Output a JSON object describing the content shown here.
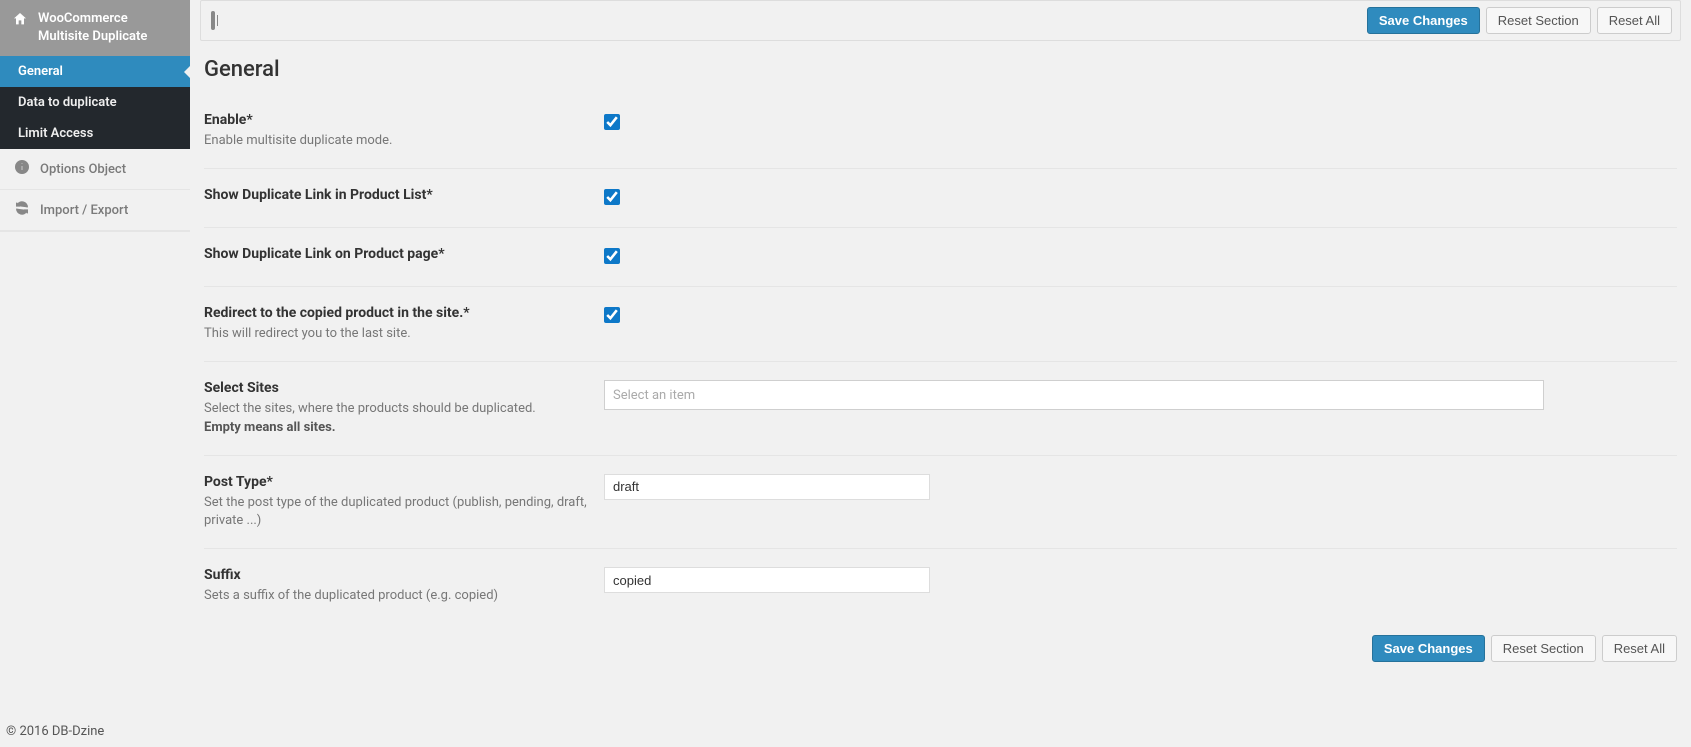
{
  "sidebar": {
    "title_line1": "WooCommerce",
    "title_line2": "Multisite Duplicate",
    "items": [
      {
        "label": "General",
        "active": true
      },
      {
        "label": "Data to duplicate",
        "active": false
      },
      {
        "label": "Limit Access",
        "active": false
      }
    ],
    "util_options_label": "Options Object",
    "util_import_label": "Import / Export"
  },
  "buttons": {
    "save": "Save Changes",
    "reset_section": "Reset Section",
    "reset_all": "Reset All"
  },
  "section": {
    "title": "General"
  },
  "fields": {
    "enable": {
      "label": "Enable*",
      "desc": "Enable multisite duplicate mode.",
      "checked": true
    },
    "show_list": {
      "label": "Show Duplicate Link in Product List*",
      "checked": true
    },
    "show_page": {
      "label": "Show Duplicate Link on Product page*",
      "checked": true
    },
    "redirect": {
      "label": "Redirect to the copied product in the site.*",
      "desc": "This will redirect you to the last site.",
      "checked": true
    },
    "select_sites": {
      "label": "Select Sites",
      "desc": "Select the sites, where the products should be duplicated. ",
      "desc_bold": "Empty means all sites.",
      "placeholder": "Select an item"
    },
    "post_type": {
      "label": "Post Type*",
      "desc": "Set the post type of the duplicated product (publish, pending, draft, private ...)",
      "value": "draft"
    },
    "suffix": {
      "label": "Suffix",
      "desc": "Sets a suffix of the duplicated product (e.g. copied)",
      "value": "copied"
    }
  },
  "footer": "© 2016 DB-Dzine"
}
